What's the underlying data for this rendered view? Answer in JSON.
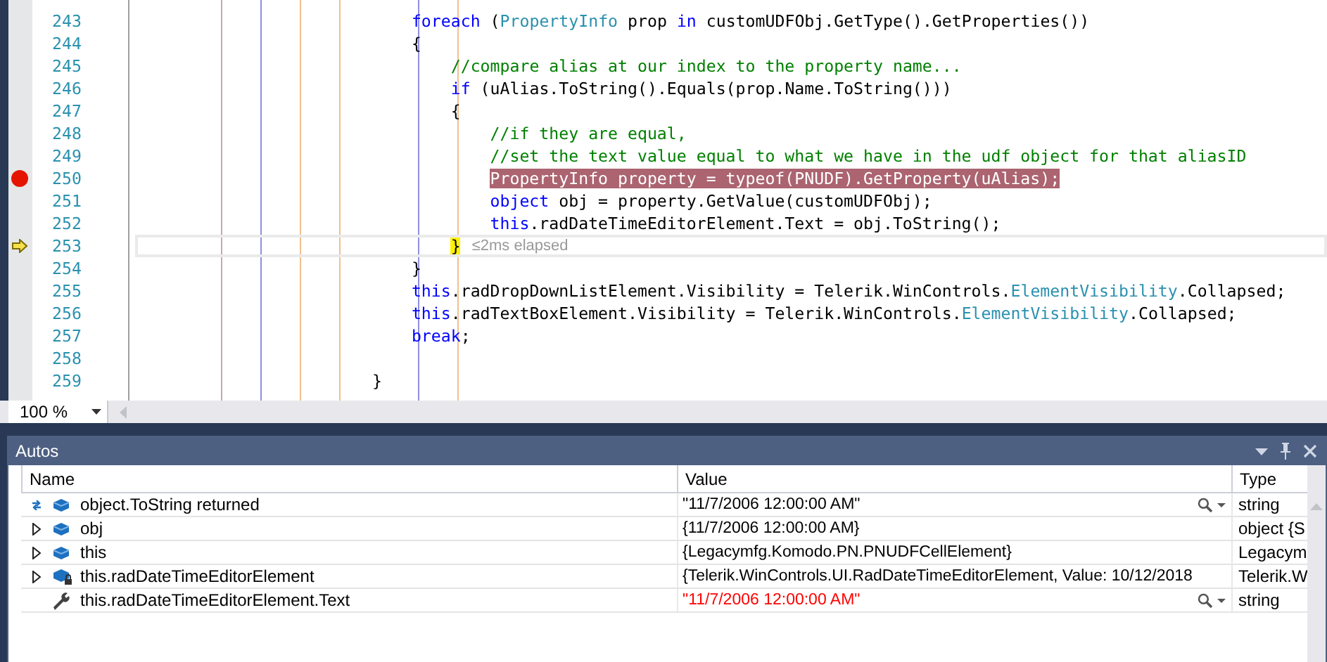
{
  "editor": {
    "lines": [
      {
        "number": "243",
        "breakpoint": false,
        "current": false,
        "tokens": [
          {
            "kind": "kw",
            "text": "                            foreach"
          },
          {
            "kind": "plain",
            "text": " ("
          },
          {
            "kind": "type",
            "text": "PropertyInfo"
          },
          {
            "kind": "plain",
            "text": " prop "
          },
          {
            "kind": "kw",
            "text": "in"
          },
          {
            "kind": "plain",
            "text": " customUDFObj.GetType().GetProperties())"
          }
        ]
      },
      {
        "number": "244",
        "breakpoint": false,
        "current": false,
        "tokens": [
          {
            "kind": "plain",
            "text": "                            {"
          }
        ]
      },
      {
        "number": "245",
        "breakpoint": false,
        "current": false,
        "tokens": [
          {
            "kind": "comment",
            "text": "                                //compare alias at our index to the property name..."
          }
        ]
      },
      {
        "number": "246",
        "breakpoint": false,
        "current": false,
        "tokens": [
          {
            "kind": "kw",
            "text": "                                if"
          },
          {
            "kind": "plain",
            "text": " (uAlias.ToString().Equals(prop.Name.ToString()))"
          }
        ]
      },
      {
        "number": "247",
        "breakpoint": false,
        "current": false,
        "tokens": [
          {
            "kind": "plain",
            "text": "                                {"
          }
        ]
      },
      {
        "number": "248",
        "breakpoint": false,
        "current": false,
        "tokens": [
          {
            "kind": "comment",
            "text": "                                    //if they are equal,"
          }
        ]
      },
      {
        "number": "249",
        "breakpoint": false,
        "current": false,
        "tokens": [
          {
            "kind": "comment",
            "text": "                                    //set the text value equal to what we have in the udf object for that aliasID"
          }
        ]
      },
      {
        "number": "250",
        "breakpoint": true,
        "current": false,
        "tokens": [
          {
            "kind": "bp",
            "text": "                                    PropertyInfo property = typeof(PNUDF).GetProperty(uAlias);"
          }
        ]
      },
      {
        "number": "251",
        "breakpoint": false,
        "current": false,
        "tokens": [
          {
            "kind": "kw",
            "text": "                                    object"
          },
          {
            "kind": "plain",
            "text": " obj = property.GetValue(customUDFObj);"
          }
        ]
      },
      {
        "number": "252",
        "breakpoint": false,
        "current": false,
        "tokens": [
          {
            "kind": "kw",
            "text": "                                    this"
          },
          {
            "kind": "plain",
            "text": ".radDateTimeEditorElement.Text = obj.ToString();"
          }
        ]
      },
      {
        "number": "253",
        "breakpoint": false,
        "current": true,
        "elapsed": "≤2ms elapsed",
        "tokens": [
          {
            "kind": "cur",
            "text": "                                }"
          }
        ]
      },
      {
        "number": "254",
        "breakpoint": false,
        "current": false,
        "tokens": [
          {
            "kind": "plain",
            "text": "                            }"
          }
        ]
      },
      {
        "number": "255",
        "breakpoint": false,
        "current": false,
        "tokens": [
          {
            "kind": "kw",
            "text": "                            this"
          },
          {
            "kind": "plain",
            "text": ".radDropDownListElement.Visibility = Telerik.WinControls."
          },
          {
            "kind": "type",
            "text": "ElementVisibility"
          },
          {
            "kind": "plain",
            "text": ".Collapsed;"
          }
        ]
      },
      {
        "number": "256",
        "breakpoint": false,
        "current": false,
        "tokens": [
          {
            "kind": "kw",
            "text": "                            this"
          },
          {
            "kind": "plain",
            "text": ".radTextBoxElement.Visibility = Telerik.WinControls."
          },
          {
            "kind": "type",
            "text": "ElementVisibility"
          },
          {
            "kind": "plain",
            "text": ".Collapsed;"
          }
        ]
      },
      {
        "number": "257",
        "breakpoint": false,
        "current": false,
        "tokens": [
          {
            "kind": "kw",
            "text": "                            break"
          },
          {
            "kind": "plain",
            "text": ";"
          }
        ]
      },
      {
        "number": "258",
        "breakpoint": false,
        "current": false
      },
      {
        "number": "259",
        "breakpoint": false,
        "current": false,
        "tokens": [
          {
            "kind": "plain",
            "text": "                        }"
          }
        ]
      }
    ],
    "zoom": "100 %"
  },
  "autos": {
    "title": "Autos",
    "columns": [
      "Name",
      "Value",
      "Type"
    ],
    "rows": [
      {
        "kind": "return",
        "expandable": false,
        "name": "object.ToString returned",
        "value": "\"11/7/2006 12:00:00 AM\"",
        "changed": false,
        "visualizer": true,
        "type": "string"
      },
      {
        "kind": "field",
        "expandable": true,
        "name": "obj",
        "value": "{11/7/2006 12:00:00 AM}",
        "changed": false,
        "visualizer": false,
        "type": "object {S"
      },
      {
        "kind": "field",
        "expandable": true,
        "name": "this",
        "value": "{Legacymfg.Komodo.PN.PNUDFCellElement}",
        "changed": false,
        "visualizer": false,
        "type": "Legacym"
      },
      {
        "kind": "private",
        "expandable": true,
        "name": "this.radDateTimeEditorElement",
        "value": "{Telerik.WinControls.UI.RadDateTimeEditorElement, Value: 10/12/2018",
        "changed": false,
        "visualizer": false,
        "type": "Telerik.W"
      },
      {
        "kind": "property",
        "expandable": false,
        "name": "this.radDateTimeEditorElement.Text",
        "value": "\"11/7/2006 12:00:00 AM\"",
        "changed": true,
        "visualizer": true,
        "type": "string"
      }
    ]
  }
}
